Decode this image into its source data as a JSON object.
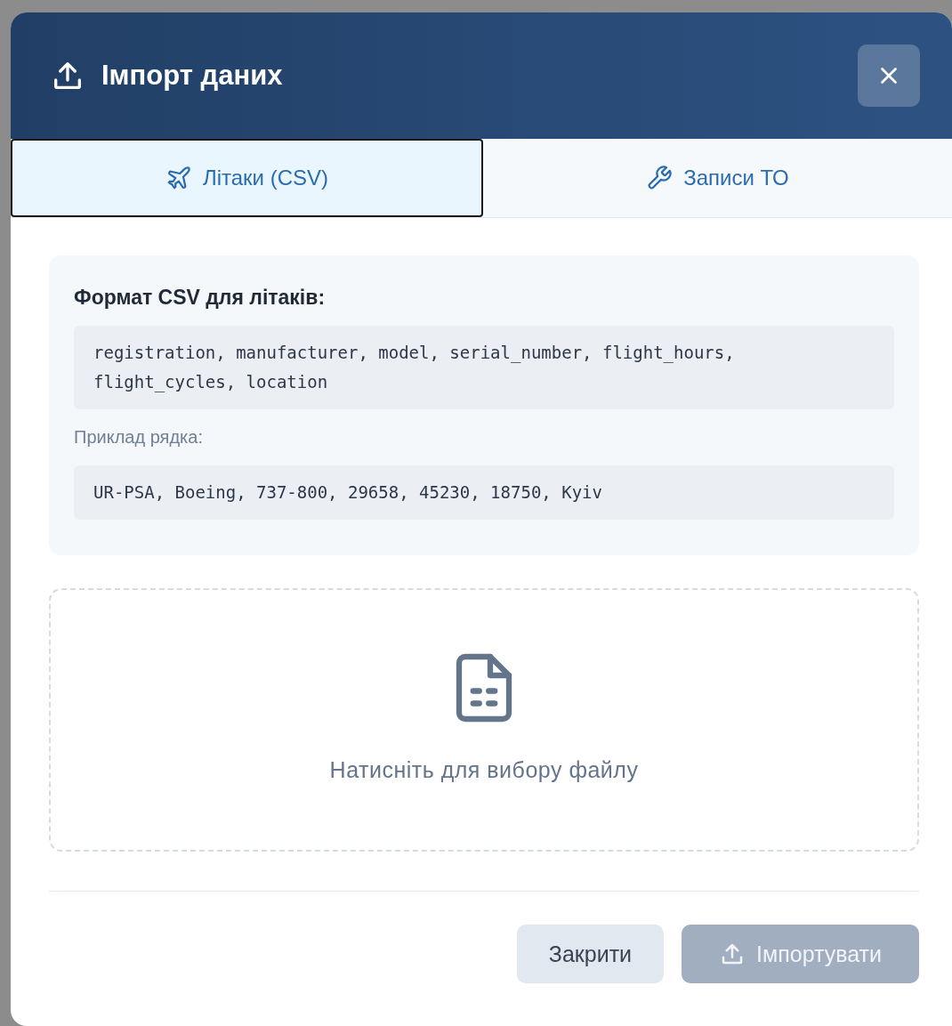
{
  "dialog": {
    "title": "Імпорт даних"
  },
  "tabs": [
    {
      "label": "Літаки (CSV)",
      "kind": "plane",
      "selected": true
    },
    {
      "label": "Записи ТО",
      "kind": "wrench",
      "selected": false
    }
  ],
  "format": {
    "heading": "Формат CSV для літаків:",
    "columns": "registration, manufacturer, model, serial_number, flight_hours, flight_cycles, location",
    "example_label": "Приклад рядка:",
    "example": "UR-PSA, Boeing, 737-800, 29658, 45230, 18750, Kyiv"
  },
  "dropzone": {
    "text": "Натисніть для вибору файлу"
  },
  "buttons": [
    {
      "label": "Закрити",
      "kind": "secondary",
      "disabled": false
    },
    {
      "label": "Імпортувати",
      "kind": "primary",
      "disabled": true
    }
  ]
}
